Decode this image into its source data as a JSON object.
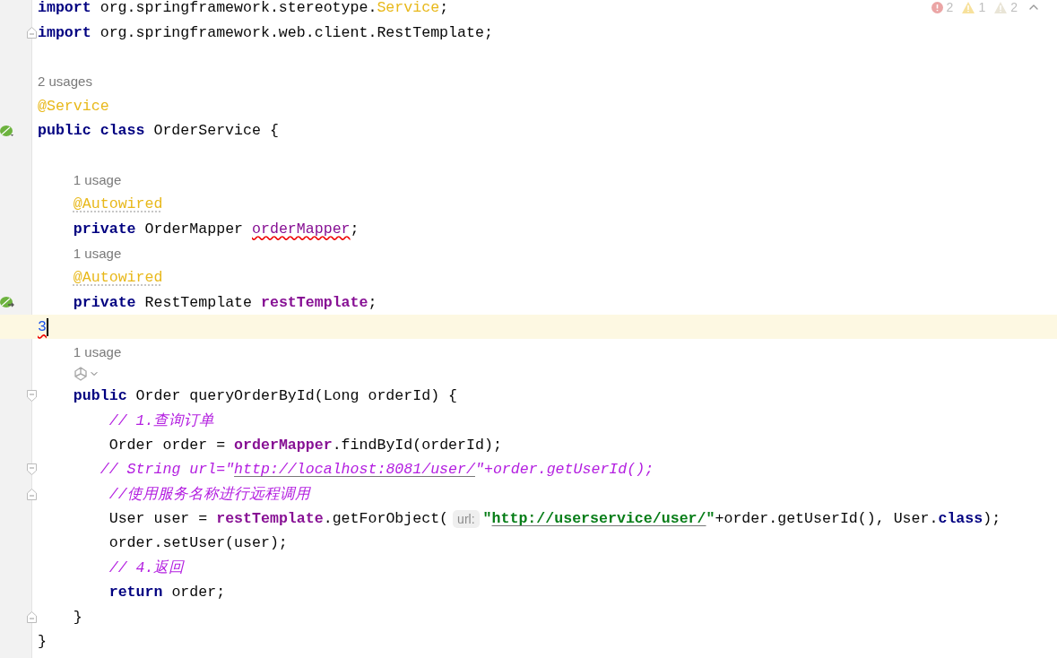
{
  "inspections": [
    {
      "kind": "error",
      "count": "2"
    },
    {
      "kind": "warning",
      "count": "1"
    },
    {
      "kind": "weak",
      "count": "2"
    }
  ],
  "lines": [
    {
      "kind": "code",
      "tokens": [
        {
          "kind": "keyword",
          "text": "import"
        },
        {
          "kind": "plain",
          "text": " org.springframework.stereotype."
        },
        {
          "kind": "annotation",
          "text": "Service"
        },
        {
          "kind": "plain",
          "text": ";"
        }
      ]
    },
    {
      "kind": "code",
      "gutter": {
        "kind": "fold-end"
      },
      "tokens": [
        {
          "kind": "keyword",
          "text": "import"
        },
        {
          "kind": "plain",
          "text": " org.springframework.web.client.RestTemplate;"
        }
      ]
    },
    {
      "kind": "blank"
    },
    {
      "kind": "hint",
      "text": "2 usages"
    },
    {
      "kind": "code",
      "tokens": [
        {
          "kind": "annotation",
          "text": "@Service"
        }
      ]
    },
    {
      "kind": "code",
      "gutter": {
        "kind": "bean"
      },
      "tokens": [
        {
          "kind": "keyword",
          "text": "public class"
        },
        {
          "kind": "plain",
          "text": " OrderService {"
        }
      ]
    },
    {
      "kind": "blank"
    },
    {
      "kind": "hint",
      "text": "    1 usage"
    },
    {
      "kind": "code",
      "tokens": [
        {
          "kind": "annotation-weak",
          "text": "    @Autowired"
        }
      ]
    },
    {
      "kind": "code",
      "tokens": [
        {
          "kind": "keyword",
          "text": "    private"
        },
        {
          "kind": "plain",
          "text": " OrderMapper "
        },
        {
          "kind": "field-typo",
          "text": "orderMapper"
        },
        {
          "kind": "plain",
          "text": ";"
        }
      ]
    },
    {
      "kind": "hint",
      "text": "    1 usage"
    },
    {
      "kind": "code",
      "tokens": [
        {
          "kind": "annotation-weak",
          "text": "    @Autowired"
        }
      ]
    },
    {
      "kind": "code",
      "gutter": {
        "kind": "bean-arrow"
      },
      "tokens": [
        {
          "kind": "keyword",
          "text": "    private"
        },
        {
          "kind": "plain",
          "text": " RestTemplate "
        },
        {
          "kind": "field",
          "text": "restTemplate"
        },
        {
          "kind": "plain",
          "text": ";"
        }
      ]
    },
    {
      "kind": "code",
      "current": true,
      "caret": true,
      "tokens": [
        {
          "kind": "error-number",
          "text": "3"
        }
      ]
    },
    {
      "kind": "hint",
      "text": "    1 usage"
    },
    {
      "kind": "icons"
    },
    {
      "kind": "code",
      "gutter": {
        "kind": "fold-start"
      },
      "tokens": [
        {
          "kind": "keyword",
          "text": "    public"
        },
        {
          "kind": "plain",
          "text": " Order queryOrderById(Long orderId) {"
        }
      ]
    },
    {
      "kind": "code",
      "tokens": [
        {
          "kind": "comment",
          "text": "        // 1.查询订单"
        }
      ]
    },
    {
      "kind": "code",
      "tokens": [
        {
          "kind": "plain",
          "text": "        Order order = "
        },
        {
          "kind": "field",
          "text": "orderMapper"
        },
        {
          "kind": "plain",
          "text": ".findById(orderId);"
        }
      ]
    },
    {
      "kind": "code",
      "gutter": {
        "kind": "fold-start"
      },
      "tokens": [
        {
          "kind": "comment",
          "text": "       // String url=\""
        },
        {
          "kind": "comment-link",
          "text": "http://localhost:8081/user/"
        },
        {
          "kind": "comment",
          "text": "\"+order.getUserId();"
        }
      ]
    },
    {
      "kind": "code",
      "gutter": {
        "kind": "fold-end"
      },
      "tokens": [
        {
          "kind": "comment",
          "text": "        //使用服务名称进行远程调用"
        }
      ]
    },
    {
      "kind": "code",
      "tokens": [
        {
          "kind": "plain",
          "text": "        User user = "
        },
        {
          "kind": "field",
          "text": "restTemplate"
        },
        {
          "kind": "plain",
          "text": ".getForObject("
        },
        {
          "kind": "inlay",
          "text": "url:"
        },
        {
          "kind": "string",
          "text": "\""
        },
        {
          "kind": "string-link",
          "text": "http://userservice/user/"
        },
        {
          "kind": "string",
          "text": "\""
        },
        {
          "kind": "plain",
          "text": "+order.getUserId(), User."
        },
        {
          "kind": "keyword",
          "text": "class"
        },
        {
          "kind": "plain",
          "text": ");"
        }
      ]
    },
    {
      "kind": "code",
      "tokens": [
        {
          "kind": "plain",
          "text": "        order.setUser(user);"
        }
      ]
    },
    {
      "kind": "code",
      "tokens": [
        {
          "kind": "comment",
          "text": "        // 4.返回"
        }
      ]
    },
    {
      "kind": "code",
      "tokens": [
        {
          "kind": "keyword",
          "text": "        return"
        },
        {
          "kind": "plain",
          "text": " order;"
        }
      ]
    },
    {
      "kind": "code",
      "gutter": {
        "kind": "fold-end"
      },
      "tokens": [
        {
          "kind": "plain",
          "text": "    }"
        }
      ]
    },
    {
      "kind": "code",
      "tokens": [
        {
          "kind": "plain",
          "text": "}"
        }
      ]
    }
  ]
}
